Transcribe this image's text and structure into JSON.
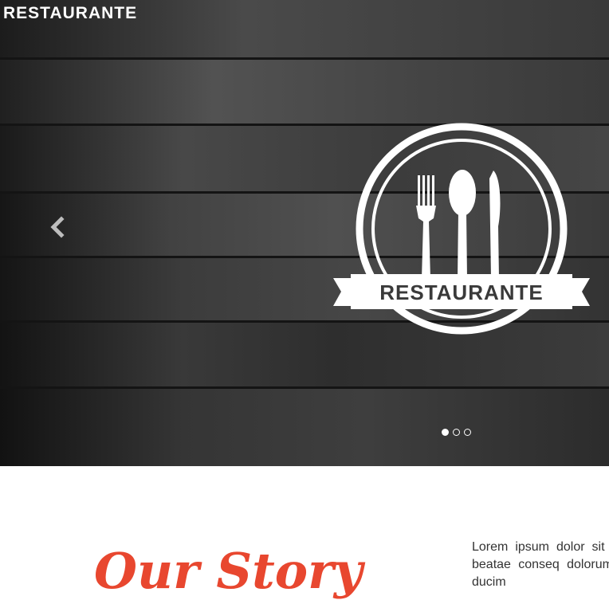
{
  "header": {
    "brand": "RESTAURANTE"
  },
  "hero": {
    "emblem_text": "RESTAURANTE",
    "prev_icon": "chevron-left-icon",
    "slides_total": 3,
    "active_slide": 1
  },
  "story": {
    "title": "Our Story",
    "text": "Lorem ipsum dolor sit autem beatae conseq dolorum esse ducim"
  },
  "colors": {
    "accent": "#e8472f",
    "text": "#333333",
    "hero_dark": "#1a1a1a"
  }
}
